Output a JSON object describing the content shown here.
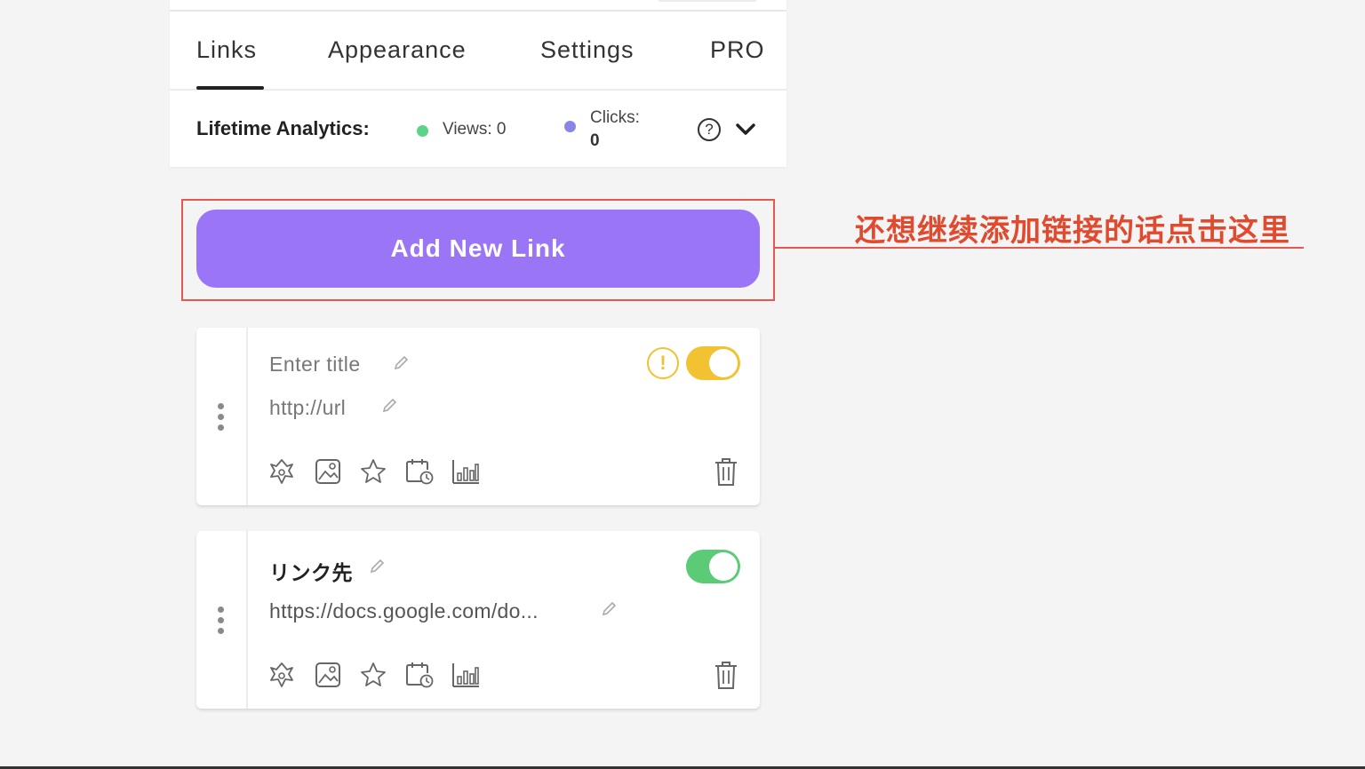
{
  "tabs": [
    {
      "label": "Links",
      "active": true
    },
    {
      "label": "Appearance",
      "active": false
    },
    {
      "label": "Settings",
      "active": false
    },
    {
      "label": "PRO",
      "active": false
    }
  ],
  "analytics": {
    "label": "Lifetime Analytics:",
    "views": "Views: 0",
    "clicks_label": "Clicks:",
    "clicks_value": "0"
  },
  "add_link": {
    "label": "Add New Link"
  },
  "annotation": {
    "text": "还想继续添加链接的话点击这里",
    "color": "#e04a2e"
  },
  "links": [
    {
      "title": "Enter title",
      "url": "http://url",
      "title_is_placeholder": true,
      "warning": "!",
      "enabled": true,
      "toggle_color": "#f2c232"
    },
    {
      "title": "リンク先",
      "url": "https://docs.google.com/do...",
      "title_is_placeholder": false,
      "enabled": true,
      "toggle_color": "#5ccb77"
    }
  ],
  "colors": {
    "accent": "#9a75f5",
    "views_dot": "#5cd38a",
    "clicks_dot": "#8a86e6"
  }
}
